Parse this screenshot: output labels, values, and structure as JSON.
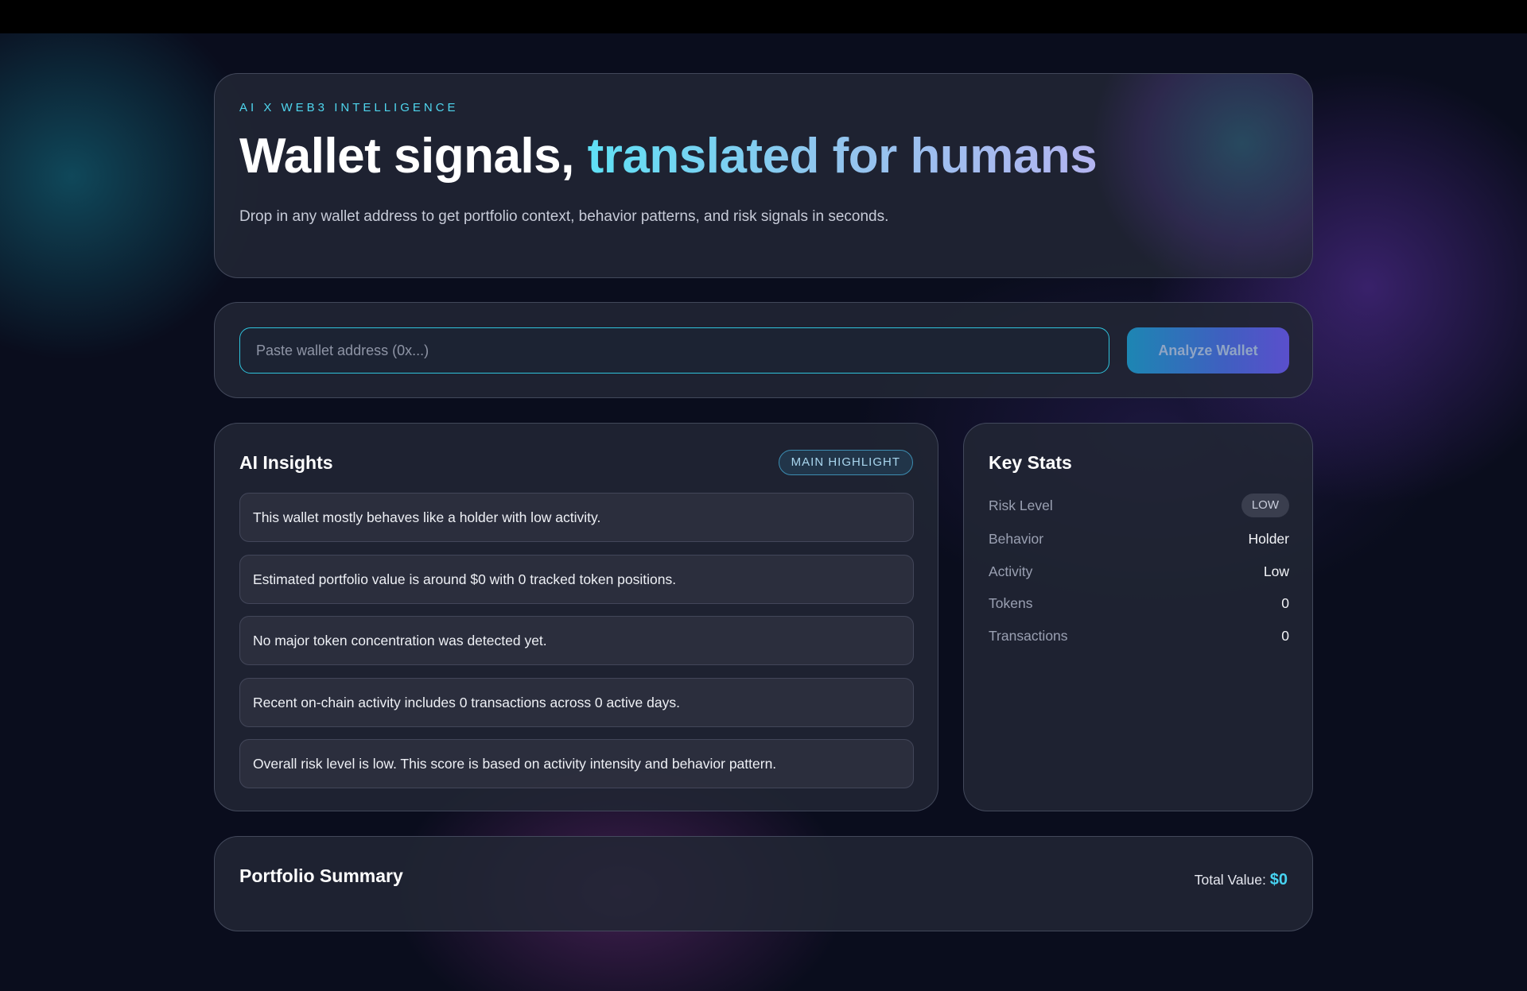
{
  "hero": {
    "eyebrow": "AI X WEB3 INTELLIGENCE",
    "title_main": "Wallet signals, ",
    "title_accent": "translated for humans",
    "subtitle": "Drop in any wallet address to get portfolio context, behavior patterns, and risk signals in seconds."
  },
  "search": {
    "placeholder": "Paste wallet address (0x...)",
    "value": "",
    "button_label": "Analyze Wallet"
  },
  "insights": {
    "title": "AI Insights",
    "badge": "MAIN HIGHLIGHT",
    "items": [
      "This wallet mostly behaves like a holder with low activity.",
      "Estimated portfolio value is around $0 with 0 tracked token positions.",
      "No major token concentration was detected yet.",
      "Recent on-chain activity includes 0 transactions across 0 active days.",
      "Overall risk level is low. This score is based on activity intensity and behavior pattern."
    ]
  },
  "stats": {
    "title": "Key Stats",
    "rows": [
      {
        "label": "Risk Level",
        "value": "LOW"
      },
      {
        "label": "Behavior",
        "value": "Holder"
      },
      {
        "label": "Activity",
        "value": "Low"
      },
      {
        "label": "Tokens",
        "value": "0"
      },
      {
        "label": "Transactions",
        "value": "0"
      }
    ]
  },
  "portfolio": {
    "title": "Portfolio Summary",
    "total_label": "Total Value:",
    "total_value": "$0"
  },
  "colors": {
    "accent_cyan": "#4fd6ee",
    "accent_violet": "#b3b4f0",
    "background": "#0a0d1d",
    "card": "#222634"
  }
}
